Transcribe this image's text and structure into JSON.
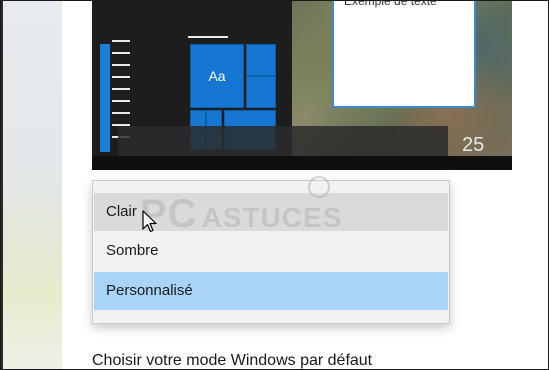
{
  "preview": {
    "sample_text": "Exemple de texte",
    "tile_label": "Aa",
    "clock": "25"
  },
  "watermark": {
    "prefix": "PC",
    "suffix": "ASTUCES"
  },
  "dropdown": {
    "options": [
      {
        "label": "Clair",
        "state": "hover"
      },
      {
        "label": "Sombre",
        "state": "normal"
      },
      {
        "label": "Personnalisé",
        "state": "selected"
      }
    ]
  },
  "footer": {
    "label": "Choisir votre mode Windows par défaut"
  },
  "colors": {
    "accent_blue": "#1577d1",
    "selected_option": "#a9d4f7",
    "hover_option": "#dadada"
  },
  "icons": {
    "cursor": "mouse-pointer-icon"
  }
}
